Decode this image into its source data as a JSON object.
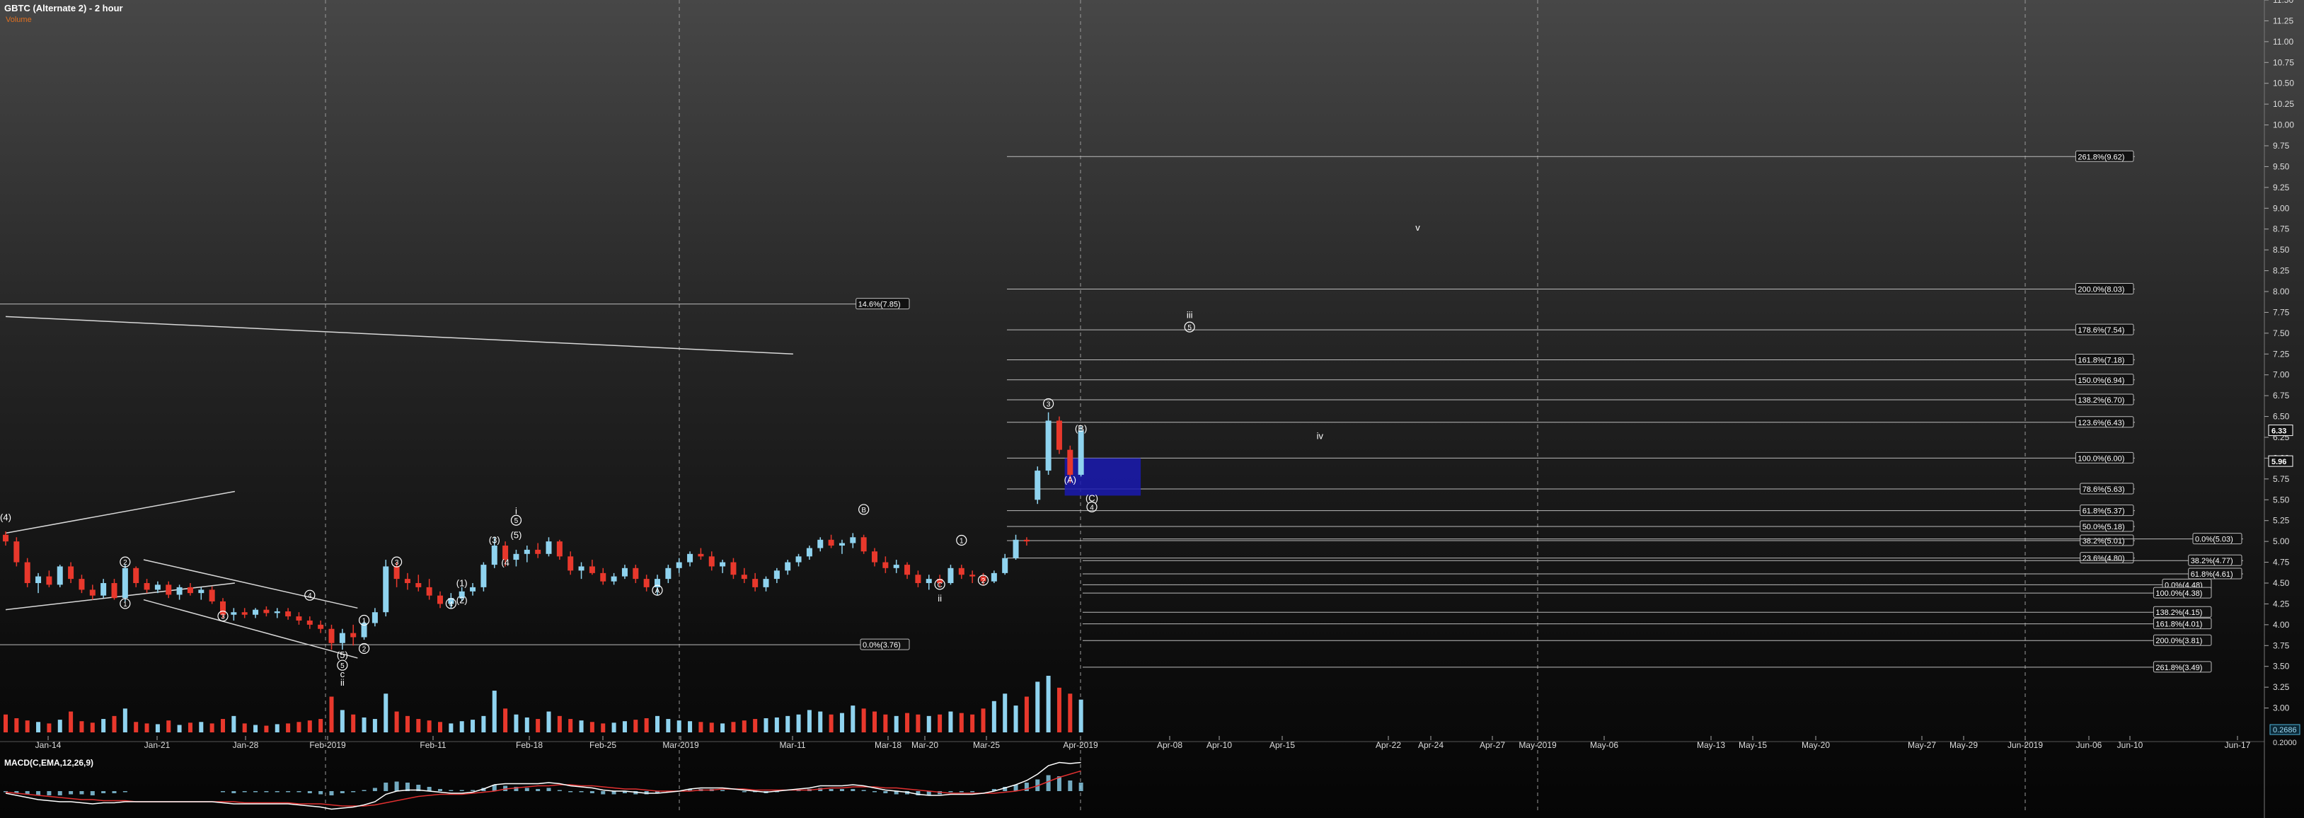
{
  "header": {
    "title": "GBTC (Alternate 2) - 2 hour",
    "subtitle": "Volume"
  },
  "macd": {
    "label": "MACD(C,EMA,12,26,9)",
    "value1": "0.2686",
    "value2": "0.2000",
    "value_color": "#4fb3d9"
  },
  "colors": {
    "up": "#8fd3ef",
    "down": "#e8382c",
    "fib_line": "#bbbbbb",
    "box": "#1a1ab0",
    "macd_line": "#ffffff",
    "signal_line": "#e03030"
  },
  "chart_data": {
    "type": "candlestick",
    "y_axis": {
      "min": 2.75,
      "max": 11.5,
      "ticks": [
        "11.50",
        "11.25",
        "11.00",
        "10.75",
        "10.50",
        "10.25",
        "10.00",
        "9.75",
        "9.50",
        "9.25",
        "9.00",
        "8.75",
        "8.50",
        "8.25",
        "8.00",
        "7.75",
        "7.50",
        "7.25",
        "7.00",
        "6.75",
        "6.50",
        "6.25",
        "6.00",
        "5.75",
        "5.50",
        "5.25",
        "5.00",
        "4.75",
        "4.50",
        "4.25",
        "4.00",
        "3.75",
        "3.50",
        "3.25",
        "3.00"
      ]
    },
    "x_axis": {
      "labels": [
        "Jan-14",
        "Jan-21",
        "Jan-28",
        "Feb-2019",
        "Feb-11",
        "Feb-18",
        "Feb-25",
        "Mar-2019",
        "Mar-11",
        "Mar-18",
        "Mar-20",
        "Mar-25",
        "Apr-2019",
        "Apr-08",
        "Apr-10",
        "Apr-15",
        "Apr-22",
        "Apr-24",
        "Apr-27",
        "May-2019",
        "May-06",
        "May-13",
        "May-15",
        "May-20",
        "May-27",
        "May-29",
        "Jun-2019",
        "Jun-06",
        "Jun-10",
        "Jun-17"
      ]
    },
    "price_badges": [
      {
        "text": "6.33",
        "value": 6.33
      },
      {
        "text": "5.96",
        "value": 5.96
      }
    ],
    "fib_levels": [
      {
        "label": "261.8%(9.62)",
        "value": 9.62,
        "group": "upper"
      },
      {
        "label": "200.0%(8.03)",
        "value": 8.03,
        "group": "upper"
      },
      {
        "label": "178.6%(7.54)",
        "value": 7.54,
        "group": "upper"
      },
      {
        "label": "161.8%(7.18)",
        "value": 7.18,
        "group": "upper"
      },
      {
        "label": "150.0%(6.94)",
        "value": 6.94,
        "group": "upper"
      },
      {
        "label": "138.2%(6.70)",
        "value": 6.7,
        "group": "upper"
      },
      {
        "label": "123.6%(6.43)",
        "value": 6.43,
        "group": "upper"
      },
      {
        "label": "100.0%(6.00)",
        "value": 6.0,
        "group": "upper"
      },
      {
        "label": "78.6%(5.63)",
        "value": 5.63,
        "group": "upper"
      },
      {
        "label": "61.8%(5.37)",
        "value": 5.37,
        "group": "upper"
      },
      {
        "label": "50.0%(5.18)",
        "value": 5.18,
        "group": "upper"
      },
      {
        "label": "38.2%(5.01)",
        "value": 5.01,
        "group": "upper"
      },
      {
        "label": "23.6%(4.80)",
        "value": 4.8,
        "group": "upper"
      },
      {
        "label": "0.0%(5.03)",
        "value": 5.03,
        "group": "right"
      },
      {
        "label": "38.2%(4.77)",
        "value": 4.77,
        "group": "right"
      },
      {
        "label": "61.8%(4.61)",
        "value": 4.61,
        "group": "right"
      },
      {
        "label": "0.0%(4.48)",
        "value": 4.48,
        "group": "mid"
      },
      {
        "label": "100.0%(4.38)",
        "value": 4.38,
        "group": "mid"
      },
      {
        "label": "138.2%(4.15)",
        "value": 4.15,
        "group": "mid"
      },
      {
        "label": "161.8%(4.01)",
        "value": 4.01,
        "group": "mid"
      },
      {
        "label": "200.0%(3.81)",
        "value": 3.81,
        "group": "mid"
      },
      {
        "label": "261.8%(3.49)",
        "value": 3.49,
        "group": "mid"
      },
      {
        "label": "14.6%(7.85)",
        "value": 7.85,
        "group": "left"
      },
      {
        "label": "0.0%(3.76)",
        "value": 3.76,
        "group": "left"
      }
    ],
    "wave_labels": [
      {
        "text": "(4)",
        "date_idx": 0,
        "value": 5.25
      },
      {
        "text": "2",
        "date_idx": 11,
        "value": 4.72
      },
      {
        "text": "1",
        "date_idx": 11,
        "value": 4.22
      },
      {
        "text": "3",
        "date_idx": 20,
        "value": 4.07
      },
      {
        "text": "4",
        "date_idx": 28,
        "value": 4.32
      },
      {
        "text": "(5)",
        "date_idx": 31,
        "value": 3.6
      },
      {
        "text": "5",
        "date_idx": 31,
        "value": 3.48
      },
      {
        "text": "c",
        "date_idx": 31,
        "value": 3.37
      },
      {
        "text": "ii",
        "date_idx": 31,
        "value": 3.27
      },
      {
        "text": "1",
        "date_idx": 33,
        "value": 4.02
      },
      {
        "text": "2",
        "date_idx": 33,
        "value": 3.68
      },
      {
        "text": "3",
        "date_idx": 36,
        "value": 4.72
      },
      {
        "text": "4",
        "date_idx": 41,
        "value": 4.22
      },
      {
        "text": "(1)",
        "date_idx": 42,
        "value": 4.46
      },
      {
        "text": "(2)",
        "date_idx": 42,
        "value": 4.26
      },
      {
        "text": "(3)",
        "date_idx": 45,
        "value": 4.98
      },
      {
        "text": "(4",
        "date_idx": 46,
        "value": 4.71
      },
      {
        "text": "i",
        "date_idx": 47,
        "value": 5.33
      },
      {
        "text": "5",
        "date_idx": 47,
        "value": 5.22
      },
      {
        "text": "(5)",
        "date_idx": 47,
        "value": 5.04
      },
      {
        "text": "A",
        "date_idx": 60,
        "value": 4.38
      },
      {
        "text": "B",
        "date_idx": 79,
        "value": 5.35
      },
      {
        "text": "C",
        "date_idx": 86,
        "value": 4.45
      },
      {
        "text": "ii",
        "date_idx": 86,
        "value": 4.28
      },
      {
        "text": "1",
        "date_idx": 88,
        "value": 4.98
      },
      {
        "text": "2",
        "date_idx": 90,
        "value": 4.5
      },
      {
        "text": "3",
        "date_idx": 96,
        "value": 6.62
      },
      {
        "text": "(B)",
        "date_idx": 99,
        "value": 6.32
      },
      {
        "text": "(A)",
        "date_idx": 98,
        "value": 5.7
      },
      {
        "text": "(C)",
        "date_idx": 100,
        "value": 5.48
      },
      {
        "text": "4",
        "date_idx": 100,
        "value": 5.38
      },
      {
        "text": "iii",
        "date_idx": 109,
        "value": 7.68
      },
      {
        "text": "5",
        "date_idx": 109,
        "value": 7.54
      },
      {
        "text": "iv",
        "date_idx": 121,
        "value": 6.23
      },
      {
        "text": "v",
        "date_idx": 130,
        "value": 8.73
      }
    ],
    "candles": [
      [
        5.08,
        5.12,
        4.95,
        5.0
      ],
      [
        5.0,
        5.05,
        4.7,
        4.75
      ],
      [
        4.75,
        4.8,
        4.45,
        4.5
      ],
      [
        4.5,
        4.62,
        4.38,
        4.58
      ],
      [
        4.58,
        4.65,
        4.45,
        4.48
      ],
      [
        4.48,
        4.72,
        4.45,
        4.7
      ],
      [
        4.7,
        4.75,
        4.5,
        4.55
      ],
      [
        4.55,
        4.6,
        4.38,
        4.42
      ],
      [
        4.42,
        4.48,
        4.3,
        4.35
      ],
      [
        4.35,
        4.55,
        4.32,
        4.5
      ],
      [
        4.5,
        4.55,
        4.3,
        4.32
      ],
      [
        4.32,
        4.72,
        4.28,
        4.68
      ],
      [
        4.68,
        4.7,
        4.45,
        4.5
      ],
      [
        4.5,
        4.55,
        4.38,
        4.42
      ],
      [
        4.42,
        4.52,
        4.38,
        4.48
      ],
      [
        4.48,
        4.52,
        4.32,
        4.36
      ],
      [
        4.36,
        4.48,
        4.3,
        4.45
      ],
      [
        4.45,
        4.5,
        4.35,
        4.38
      ],
      [
        4.38,
        4.45,
        4.3,
        4.42
      ],
      [
        4.42,
        4.46,
        4.25,
        4.28
      ],
      [
        4.28,
        4.32,
        4.08,
        4.12
      ],
      [
        4.12,
        4.2,
        4.05,
        4.15
      ],
      [
        4.15,
        4.2,
        4.08,
        4.12
      ],
      [
        4.12,
        4.2,
        4.08,
        4.18
      ],
      [
        4.18,
        4.22,
        4.1,
        4.14
      ],
      [
        4.14,
        4.2,
        4.08,
        4.16
      ],
      [
        4.16,
        4.2,
        4.06,
        4.1
      ],
      [
        4.1,
        4.15,
        4.0,
        4.05
      ],
      [
        4.05,
        4.1,
        3.95,
        4.0
      ],
      [
        4.0,
        4.05,
        3.9,
        3.95
      ],
      [
        3.95,
        4.0,
        3.7,
        3.78
      ],
      [
        3.78,
        3.95,
        3.7,
        3.9
      ],
      [
        3.9,
        4.0,
        3.75,
        3.85
      ],
      [
        3.85,
        4.05,
        3.82,
        4.02
      ],
      [
        4.02,
        4.2,
        3.98,
        4.15
      ],
      [
        4.15,
        4.78,
        4.1,
        4.7
      ],
      [
        4.7,
        4.75,
        4.45,
        4.55
      ],
      [
        4.55,
        4.62,
        4.42,
        4.5
      ],
      [
        4.5,
        4.6,
        4.4,
        4.45
      ],
      [
        4.45,
        4.55,
        4.3,
        4.35
      ],
      [
        4.35,
        4.4,
        4.2,
        4.25
      ],
      [
        4.25,
        4.38,
        4.2,
        4.32
      ],
      [
        4.32,
        4.45,
        4.28,
        4.4
      ],
      [
        4.4,
        4.5,
        4.35,
        4.45
      ],
      [
        4.45,
        4.75,
        4.4,
        4.72
      ],
      [
        4.72,
        5.05,
        4.68,
        4.95
      ],
      [
        4.95,
        5.0,
        4.7,
        4.78
      ],
      [
        4.78,
        4.9,
        4.7,
        4.85
      ],
      [
        4.85,
        4.95,
        4.75,
        4.9
      ],
      [
        4.9,
        4.98,
        4.8,
        4.85
      ],
      [
        4.85,
        5.05,
        4.82,
        5.0
      ],
      [
        5.0,
        5.02,
        4.78,
        4.82
      ],
      [
        4.82,
        4.88,
        4.6,
        4.65
      ],
      [
        4.65,
        4.75,
        4.55,
        4.7
      ],
      [
        4.7,
        4.78,
        4.6,
        4.62
      ],
      [
        4.62,
        4.68,
        4.48,
        4.52
      ],
      [
        4.52,
        4.62,
        4.48,
        4.58
      ],
      [
        4.58,
        4.72,
        4.55,
        4.68
      ],
      [
        4.68,
        4.72,
        4.5,
        4.55
      ],
      [
        4.55,
        4.6,
        4.4,
        4.45
      ],
      [
        4.45,
        4.6,
        4.35,
        4.55
      ],
      [
        4.55,
        4.72,
        4.5,
        4.68
      ],
      [
        4.68,
        4.8,
        4.62,
        4.75
      ],
      [
        4.75,
        4.88,
        4.7,
        4.85
      ],
      [
        4.85,
        4.92,
        4.78,
        4.82
      ],
      [
        4.82,
        4.88,
        4.65,
        4.7
      ],
      [
        4.7,
        4.78,
        4.62,
        4.75
      ],
      [
        4.75,
        4.8,
        4.55,
        4.6
      ],
      [
        4.6,
        4.68,
        4.5,
        4.55
      ],
      [
        4.55,
        4.62,
        4.4,
        4.45
      ],
      [
        4.45,
        4.58,
        4.4,
        4.55
      ],
      [
        4.55,
        4.68,
        4.5,
        4.65
      ],
      [
        4.65,
        4.78,
        4.6,
        4.75
      ],
      [
        4.75,
        4.85,
        4.7,
        4.82
      ],
      [
        4.82,
        4.95,
        4.78,
        4.92
      ],
      [
        4.92,
        5.05,
        4.88,
        5.02
      ],
      [
        5.02,
        5.08,
        4.92,
        4.95
      ],
      [
        4.95,
        5.02,
        4.85,
        4.98
      ],
      [
        4.98,
        5.1,
        4.92,
        5.05
      ],
      [
        5.05,
        5.08,
        4.85,
        4.88
      ],
      [
        4.88,
        4.92,
        4.7,
        4.75
      ],
      [
        4.75,
        4.82,
        4.62,
        4.68
      ],
      [
        4.68,
        4.78,
        4.62,
        4.72
      ],
      [
        4.72,
        4.75,
        4.55,
        4.6
      ],
      [
        4.6,
        4.65,
        4.45,
        4.5
      ],
      [
        4.5,
        4.6,
        4.42,
        4.55
      ],
      [
        4.55,
        4.6,
        4.45,
        4.5
      ],
      [
        4.5,
        4.72,
        4.48,
        4.68
      ],
      [
        4.68,
        4.72,
        4.55,
        4.6
      ],
      [
        4.6,
        4.65,
        4.5,
        4.58
      ],
      [
        4.58,
        4.62,
        4.48,
        4.52
      ],
      [
        4.52,
        4.65,
        4.5,
        4.62
      ],
      [
        4.62,
        4.85,
        4.6,
        4.8
      ],
      [
        4.8,
        5.08,
        4.78,
        5.02
      ],
      [
        5.02,
        5.05,
        4.95,
        5.0
      ],
      [
        5.5,
        5.9,
        5.45,
        5.85
      ],
      [
        5.85,
        6.55,
        5.8,
        6.45
      ],
      [
        6.45,
        6.5,
        6.05,
        6.1
      ],
      [
        6.1,
        6.15,
        5.7,
        5.8
      ],
      [
        5.8,
        6.38,
        5.78,
        6.33
      ]
    ],
    "volume": [
      120,
      95,
      80,
      70,
      60,
      85,
      140,
      75,
      65,
      90,
      110,
      160,
      70,
      60,
      55,
      80,
      50,
      65,
      70,
      60,
      90,
      110,
      60,
      50,
      45,
      55,
      60,
      70,
      80,
      90,
      240,
      150,
      120,
      100,
      90,
      260,
      140,
      110,
      90,
      80,
      70,
      60,
      75,
      85,
      110,
      280,
      160,
      120,
      100,
      90,
      140,
      110,
      90,
      80,
      70,
      60,
      65,
      75,
      85,
      95,
      110,
      90,
      80,
      75,
      70,
      65,
      60,
      70,
      80,
      90,
      95,
      100,
      110,
      120,
      150,
      140,
      120,
      130,
      180,
      160,
      140,
      120,
      110,
      130,
      120,
      110,
      120,
      140,
      130,
      120,
      160,
      210,
      260,
      180,
      240,
      340,
      380,
      300,
      260,
      220
    ],
    "macd_line": [
      -0.02,
      -0.04,
      -0.06,
      -0.08,
      -0.09,
      -0.1,
      -0.1,
      -0.11,
      -0.12,
      -0.11,
      -0.11,
      -0.1,
      -0.1,
      -0.1,
      -0.1,
      -0.1,
      -0.1,
      -0.1,
      -0.1,
      -0.1,
      -0.11,
      -0.12,
      -0.12,
      -0.12,
      -0.12,
      -0.12,
      -0.12,
      -0.13,
      -0.14,
      -0.15,
      -0.17,
      -0.16,
      -0.15,
      -0.13,
      -0.1,
      -0.03,
      0.0,
      0.01,
      0.01,
      0.0,
      -0.01,
      -0.02,
      -0.02,
      -0.01,
      0.02,
      0.06,
      0.07,
      0.07,
      0.07,
      0.07,
      0.08,
      0.07,
      0.05,
      0.04,
      0.03,
      0.01,
      0.0,
      0.0,
      -0.01,
      -0.02,
      -0.02,
      -0.01,
      0.0,
      0.02,
      0.03,
      0.03,
      0.03,
      0.02,
      0.01,
      0.0,
      -0.01,
      0.0,
      0.01,
      0.02,
      0.03,
      0.05,
      0.05,
      0.05,
      0.06,
      0.05,
      0.03,
      0.01,
      0.0,
      -0.01,
      -0.03,
      -0.04,
      -0.04,
      -0.03,
      -0.03,
      -0.03,
      -0.02,
      0.0,
      0.03,
      0.06,
      0.1,
      0.16,
      0.24,
      0.27,
      0.26,
      0.27
    ],
    "signal_line": [
      -0.01,
      -0.02,
      -0.03,
      -0.04,
      -0.05,
      -0.06,
      -0.07,
      -0.08,
      -0.08,
      -0.09,
      -0.09,
      -0.09,
      -0.1,
      -0.1,
      -0.1,
      -0.1,
      -0.1,
      -0.1,
      -0.1,
      -0.1,
      -0.1,
      -0.1,
      -0.11,
      -0.11,
      -0.11,
      -0.11,
      -0.11,
      -0.12,
      -0.12,
      -0.12,
      -0.13,
      -0.14,
      -0.14,
      -0.14,
      -0.13,
      -0.11,
      -0.09,
      -0.07,
      -0.05,
      -0.04,
      -0.03,
      -0.03,
      -0.03,
      -0.02,
      -0.01,
      0.0,
      0.02,
      0.03,
      0.04,
      0.05,
      0.05,
      0.06,
      0.06,
      0.05,
      0.05,
      0.04,
      0.03,
      0.02,
      0.02,
      0.01,
      0.0,
      0.0,
      0.0,
      0.0,
      0.01,
      0.01,
      0.02,
      0.02,
      0.02,
      0.01,
      0.01,
      0.01,
      0.01,
      0.01,
      0.01,
      0.02,
      0.03,
      0.03,
      0.04,
      0.04,
      0.04,
      0.03,
      0.03,
      0.02,
      0.01,
      0.0,
      -0.01,
      -0.02,
      -0.02,
      -0.02,
      -0.02,
      -0.02,
      -0.01,
      0.0,
      0.02,
      0.05,
      0.09,
      0.13,
      0.16,
      0.19
    ]
  }
}
